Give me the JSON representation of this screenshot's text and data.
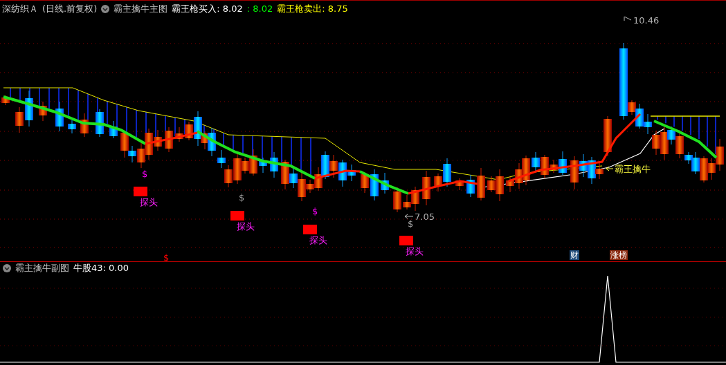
{
  "header": {
    "stock": "深纺织Ａ",
    "period": "(日线.前复权)",
    "indicator": "霸主擒牛主图",
    "readings": [
      {
        "text": "霸王枪买入: 8.02",
        "color": "#ffffff"
      },
      {
        "text": ": 8.02",
        "color": "#00ff00"
      },
      {
        "text": "霸王枪卖出: 8.75",
        "color": "#ffff00"
      }
    ]
  },
  "main_chart": {
    "high_label": "10.46",
    "low_label": "7.05",
    "signal_label": "霸王擒牛",
    "probes": [
      {
        "text": "探头"
      },
      {
        "text": "探头"
      },
      {
        "text": "探头"
      },
      {
        "text": "探头"
      }
    ],
    "dollar_marks": [
      {
        "text": "$",
        "color": "#ff00ff"
      },
      {
        "text": "$",
        "color": "#a0a0a0"
      },
      {
        "text": "$",
        "color": "#ff00ff"
      },
      {
        "text": "$",
        "color": "#a0a0a0"
      },
      {
        "text": "$",
        "color": "#ff0000"
      }
    ],
    "badges": [
      {
        "text": "财",
        "color": "#1e4a78"
      },
      {
        "text": "涨榜",
        "color": "#8a2a10"
      }
    ]
  },
  "sub_panel": {
    "title": "霸主擒牛副图",
    "reading": "牛股43: 0.00"
  }
}
